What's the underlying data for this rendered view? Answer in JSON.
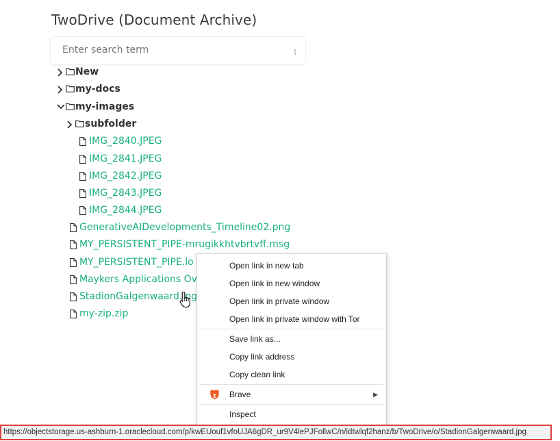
{
  "app": {
    "title": "TwoDrive (Document Archive)"
  },
  "search": {
    "placeholder": "Enter search term"
  },
  "tree": {
    "folders": {
      "new": "New",
      "my_docs": "my-docs",
      "my_images": "my-images",
      "subfolder": "subfolder"
    },
    "image_files": [
      "IMG_2840.JPEG",
      "IMG_2841.JPEG",
      "IMG_2842.JPEG",
      "IMG_2843.JPEG",
      "IMG_2844.JPEG"
    ],
    "root_files": [
      "GenerativeAIDevelopments_Timeline02.png",
      "MY_PERSISTENT_PIPE-mrugikkhtvbrtvff.msg",
      "MY_PERSISTENT_PIPE.lo",
      "Maykers Applications Ov",
      "StadionGalgenwaard.jpg",
      "my-zip.zip"
    ],
    "accent_color": "#18b080"
  },
  "context_menu": {
    "items": [
      "Open link in new tab",
      "Open link in new window",
      "Open link in private window",
      "Open link in private window with Tor",
      "Save link as...",
      "Copy link address",
      "Copy clean link",
      "Brave",
      "Inspect"
    ],
    "brave_icon": "brave-lion-icon",
    "submenu_arrow": "▶"
  },
  "status_bar": {
    "url": "https://objectstorage.us-ashburn-1.oraclecloud.com/p/kwEUouf1vfoUJA6gDR_ur9V4lePJFollwC/n/idtwlqf2hanz/b/TwoDrive/o/StadionGalgenwaard.jpg",
    "highlight_color": "#e04040"
  }
}
